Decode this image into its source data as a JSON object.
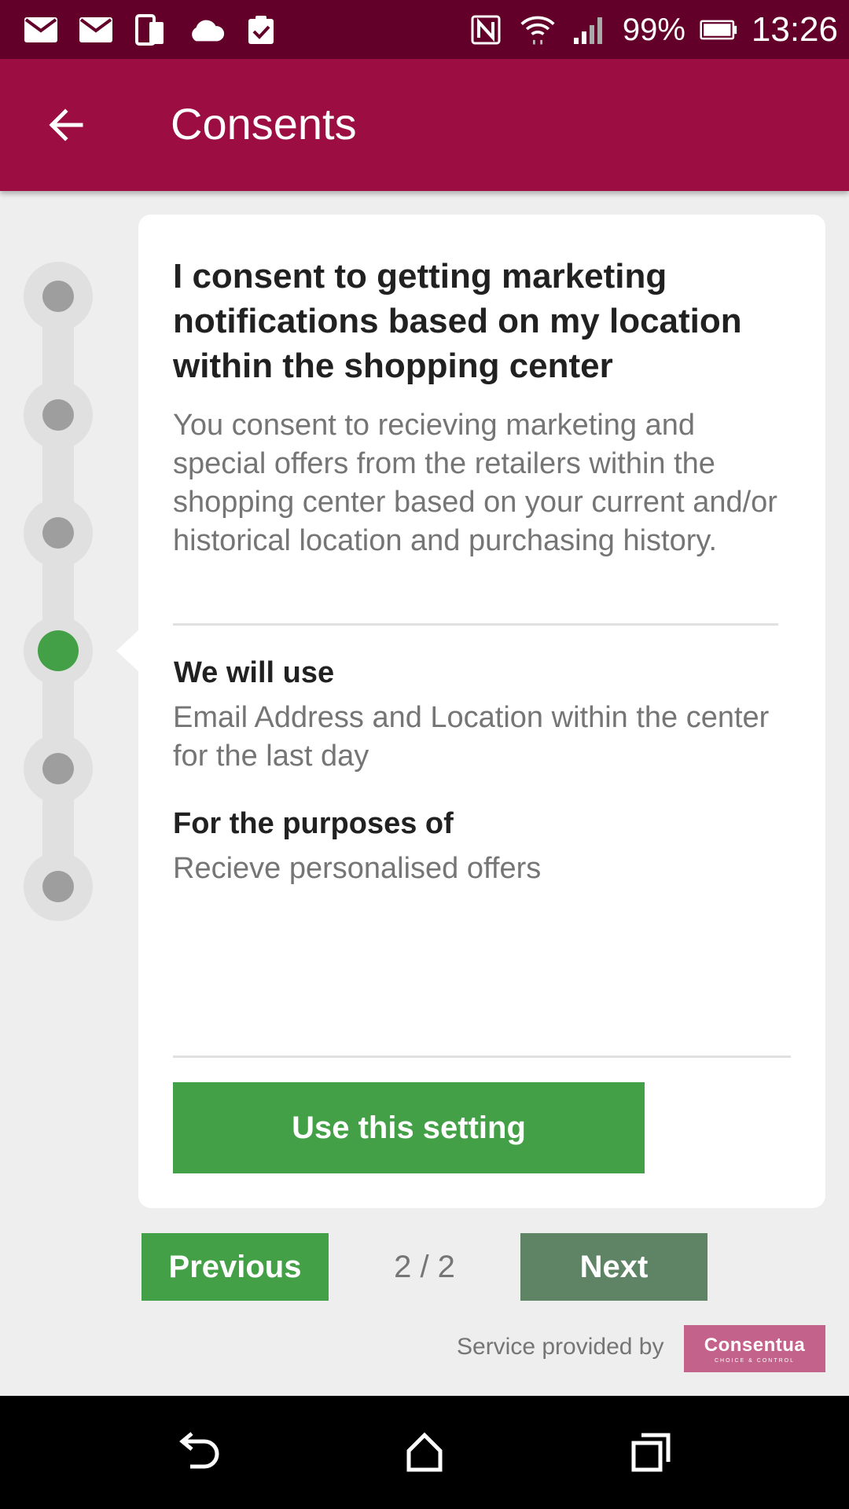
{
  "status_bar": {
    "battery": "99%",
    "time": "13:26",
    "left_icons": [
      "mail-icon",
      "mail-icon",
      "phone-tablet-icon",
      "cloud-icon",
      "clipboard-check-icon"
    ],
    "right_icons": [
      "nfc-icon",
      "wifi-icon",
      "signal-icon",
      "battery-icon"
    ]
  },
  "app_bar": {
    "title": "Consents",
    "back_icon": "arrow-back-icon"
  },
  "stepper": {
    "total_steps": 6,
    "active_step": 4,
    "active_color": "#43a047",
    "inactive_color": "#9e9e9e"
  },
  "card": {
    "title": "I consent to getting marketing notifications based on my location within the shopping center",
    "description": "You consent to recieving marketing and special offers from the retailers within the shopping center based on your current and/or historical location and purchasing history.",
    "use_heading": "We will use",
    "use_text": "Email Address and Location within the center for the last day",
    "purpose_heading": "For the purposes of",
    "purpose_text": "Recieve personalised offers",
    "action_label": "Use this setting"
  },
  "pagination": {
    "previous_label": "Previous",
    "next_label": "Next",
    "indicator": "2 / 2"
  },
  "footer": {
    "service_text": "Service provided by",
    "brand_name": "Consentua",
    "brand_tagline": "CHOICE & CONTROL"
  },
  "colors": {
    "status_bar": "#63002a",
    "app_bar": "#9c0d41",
    "primary_green": "#43a047",
    "next_green": "#5f8465",
    "brand": "#c3628a"
  }
}
